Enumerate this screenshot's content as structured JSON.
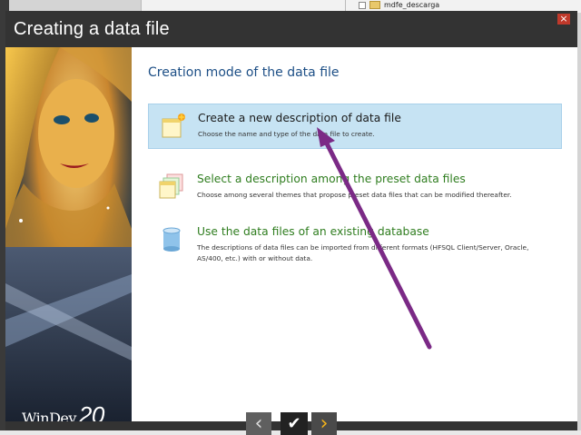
{
  "background": {
    "tree_item": "mdfe_descarga",
    "bottom_text": "..."
  },
  "dialog": {
    "title": "Creating a data file",
    "close_label": "×",
    "section_title": "Creation mode of the data file",
    "options": [
      {
        "title": "Create a new description of data file",
        "description": "Choose the name and type of the data file to create.",
        "selected": true
      },
      {
        "title": "Select a description among the preset data files",
        "description": "Choose among several themes that propose preset data files that can be modified thereafter.",
        "selected": false
      },
      {
        "title": "Use the data files of an existing database",
        "description": "The descriptions of data files can be imported from different formats (HFSQL Client/Server, Oracle, AS/400, etc.) with or without data.",
        "selected": false
      }
    ],
    "logo": {
      "text": "WinDev",
      "version": "20"
    },
    "nav": {
      "prev": "‹",
      "ok": "✔",
      "next": "›"
    }
  },
  "colors": {
    "title_bar": "#333333",
    "selected_bg": "#c6e3f3",
    "section_title": "#1d4f86",
    "option_title_green": "#2f7d1f",
    "arrow": "#7b2a86"
  }
}
